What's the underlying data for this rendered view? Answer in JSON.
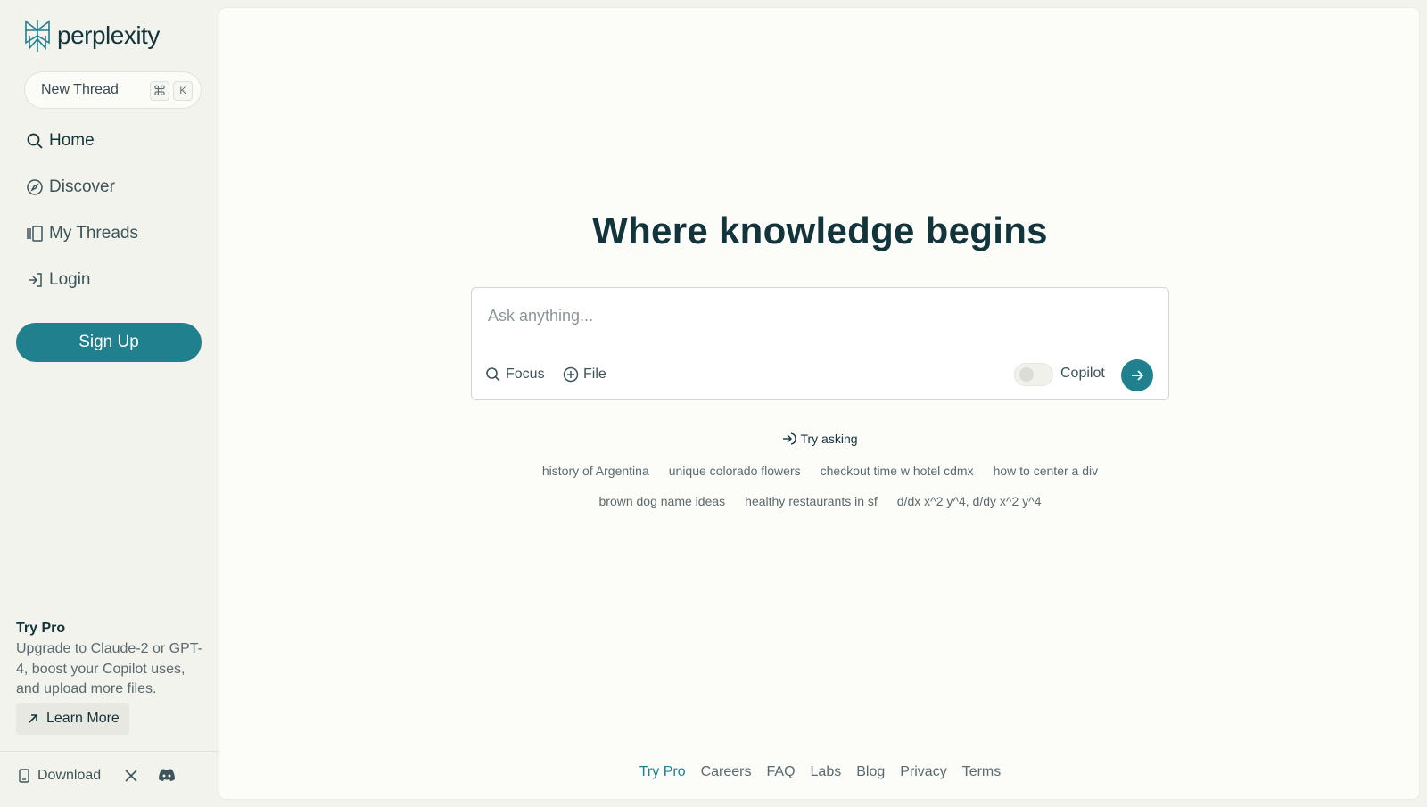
{
  "sidebar": {
    "logo_text": "perplexity",
    "new_thread": {
      "label": "New Thread",
      "shortcut_cmd": "⌘",
      "shortcut_key": "K"
    },
    "nav": [
      {
        "label": "Home",
        "icon": "search-icon"
      },
      {
        "label": "Discover",
        "icon": "compass-icon"
      },
      {
        "label": "My Threads",
        "icon": "threads-icon"
      },
      {
        "label": "Login",
        "icon": "login-icon"
      }
    ],
    "signup_label": "Sign Up",
    "try_pro": {
      "title": "Try Pro",
      "description": "Upgrade to Claude-2 or GPT-4, boost your Copilot uses, and upload more files.",
      "learn_more": "Learn More"
    },
    "download_label": "Download"
  },
  "main": {
    "headline": "Where knowledge begins",
    "search": {
      "placeholder": "Ask anything...",
      "focus_label": "Focus",
      "file_label": "File",
      "copilot_label": "Copilot"
    },
    "try_asking": "Try asking",
    "suggestions_row1": [
      "history of Argentina",
      "unique colorado flowers",
      "checkout time w hotel cdmx",
      "how to center a div"
    ],
    "suggestions_row2": [
      "brown dog name ideas",
      "healthy restaurants in sf",
      "d/dx x^2 y^4, d/dy x^2 y^4"
    ],
    "footer": [
      "Try Pro",
      "Careers",
      "FAQ",
      "Labs",
      "Blog",
      "Privacy",
      "Terms"
    ]
  },
  "colors": {
    "accent": "#20808d",
    "text": "#13343b",
    "background": "#f3f3ee",
    "panel": "#fcfcf9"
  }
}
